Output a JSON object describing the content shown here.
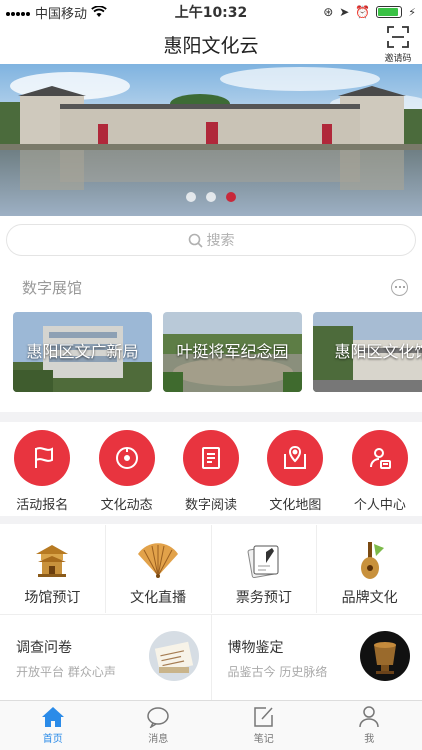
{
  "status": {
    "carrier": "中国移动",
    "time": "上午10:32"
  },
  "header": {
    "title": "惠阳文化云",
    "invite_label": "邀请码"
  },
  "banner": {
    "active_index": 2,
    "count": 3
  },
  "search": {
    "placeholder": "搜索"
  },
  "section": {
    "title": "数字展馆"
  },
  "halls": [
    {
      "label": "惠阳区文广新局"
    },
    {
      "label": "叶挺将军纪念园"
    },
    {
      "label": "惠阳区文化馆"
    }
  ],
  "features": [
    {
      "label": "活动报名",
      "icon": "flag-icon"
    },
    {
      "label": "文化动态",
      "icon": "activity-icon"
    },
    {
      "label": "数字阅读",
      "icon": "book-icon"
    },
    {
      "label": "文化地图",
      "icon": "map-icon"
    },
    {
      "label": "个人中心",
      "icon": "user-card-icon"
    }
  ],
  "services": [
    {
      "label": "场馆预订",
      "icon": "pavilion-icon"
    },
    {
      "label": "文化直播",
      "icon": "fan-icon"
    },
    {
      "label": "票务预订",
      "icon": "ticket-icon"
    },
    {
      "label": "品牌文化",
      "icon": "instrument-icon"
    }
  ],
  "cards": [
    {
      "title": "调查问卷",
      "subtitle": "开放平台 群众心声"
    },
    {
      "title": "博物鉴定",
      "subtitle": "品鉴古今 历史脉络"
    }
  ],
  "tabs": [
    {
      "label": "首页",
      "active": true
    },
    {
      "label": "消息",
      "active": false
    },
    {
      "label": "笔记",
      "active": false
    },
    {
      "label": "我",
      "active": false
    }
  ],
  "colors": {
    "accent": "#e8343f",
    "tab_active": "#2b8be8",
    "battery": "#3ac245"
  }
}
